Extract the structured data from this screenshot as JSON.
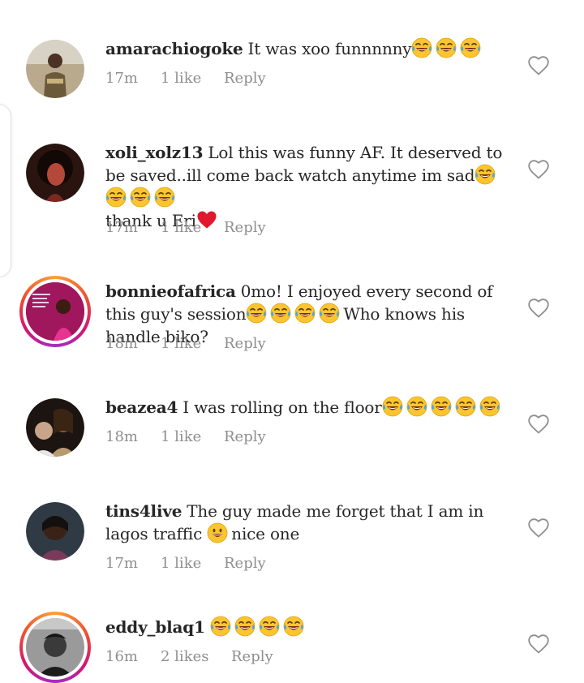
{
  "comments": [
    {
      "username": "amarachiogoke",
      "text": "It was xoo funnnnny",
      "emojis_trailing": 3,
      "time": "17m",
      "likes": "1 like",
      "reply": "Reply",
      "story_ring": false,
      "avatar_icon": "avatar-photo"
    },
    {
      "username": "xoli_xolz13",
      "text": "Lol this was funny AF. It deserved to be saved..ill come back watch anytime im sad",
      "emojis_trailing": 4,
      "text_after": "thank u Eri",
      "time": "17m",
      "likes": "1 like",
      "reply": "Reply",
      "story_ring": false,
      "avatar_icon": "avatar-photo"
    },
    {
      "username": "bonnieofafrica",
      "text": "0mo! I enjoyed every second of this guy's session",
      "emojis_inline": 4,
      "text_after": "Who knows his handle biko?",
      "time": "18m",
      "likes": "1 like",
      "reply": "Reply",
      "story_ring": true,
      "avatar_icon": "avatar-photo"
    },
    {
      "username": "beazea4",
      "text": "I was rolling on the floor",
      "emojis_trailing": 5,
      "time": "18m",
      "likes": "1 like",
      "reply": "Reply",
      "story_ring": false,
      "avatar_icon": "avatar-photo"
    },
    {
      "username": "tins4live",
      "text": "The guy made me forget that I am in lagos traffic",
      "emoji_grin": true,
      "text_after": "nice one",
      "time": "17m",
      "likes": "1 like",
      "reply": "Reply",
      "story_ring": false,
      "avatar_icon": "avatar-photo"
    },
    {
      "username": "eddy_blaq1",
      "text": "",
      "emojis_trailing": 4,
      "time": "16m",
      "likes": "2 likes",
      "reply": "Reply",
      "story_ring": true,
      "avatar_icon": "avatar-photo"
    }
  ],
  "icons": {
    "like": "heart-outline-icon",
    "laugh": "face-with-tears-of-joy-icon",
    "grin": "grinning-face-icon",
    "love": "red-heart-icon"
  },
  "colors": {
    "text": "#262626",
    "meta": "#8e8e8e",
    "heart_outline": "#8e8e8e",
    "story_ring_start": "#f9a13a",
    "story_ring_end": "#a42ec8"
  }
}
